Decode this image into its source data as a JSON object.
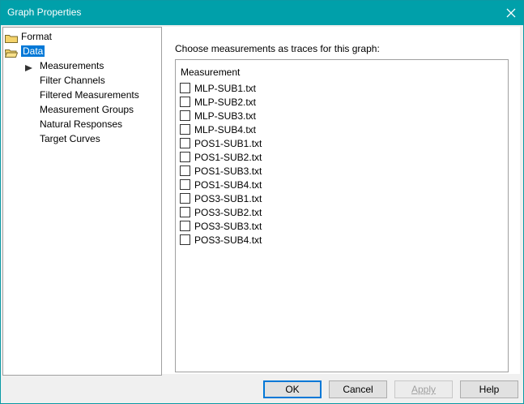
{
  "window": {
    "title": "Graph Properties"
  },
  "tree": {
    "items": [
      {
        "label": "Format",
        "icon": "folder-icon"
      },
      {
        "label": "Data",
        "icon": "folder-icon",
        "selected": true
      }
    ],
    "children": [
      {
        "label": "Measurements",
        "active": true
      },
      {
        "label": "Filter Channels"
      },
      {
        "label": "Filtered Measurements"
      },
      {
        "label": "Measurement Groups"
      },
      {
        "label": "Natural Responses"
      },
      {
        "label": "Target Curves"
      }
    ]
  },
  "panel": {
    "prompt": "Choose measurements as traces for this graph:",
    "list": {
      "header": "Measurement",
      "items": [
        "MLP-SUB1.txt",
        "MLP-SUB2.txt",
        "MLP-SUB3.txt",
        "MLP-SUB4.txt",
        "POS1-SUB1.txt",
        "POS1-SUB2.txt",
        "POS1-SUB3.txt",
        "POS1-SUB4.txt",
        "POS3-SUB1.txt",
        "POS3-SUB2.txt",
        "POS3-SUB3.txt",
        "POS3-SUB4.txt"
      ]
    }
  },
  "buttons": {
    "ok": "OK",
    "cancel": "Cancel",
    "apply": "Apply",
    "help": "Help"
  },
  "colors": {
    "titlebar": "#00a0aa",
    "selection": "#0078d7"
  }
}
